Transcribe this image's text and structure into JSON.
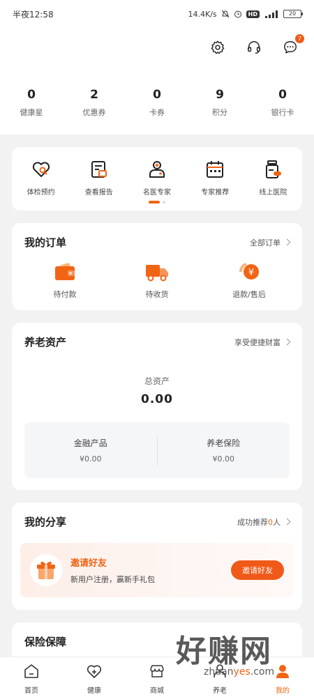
{
  "status_bar": {
    "time": "半夜12:58",
    "network_speed": "14.4K/s",
    "hd": "HD",
    "battery": "20"
  },
  "header": {
    "message_badge": "7"
  },
  "stats": [
    {
      "value": "0",
      "label": "健康星"
    },
    {
      "value": "2",
      "label": "优惠券"
    },
    {
      "value": "0",
      "label": "卡券"
    },
    {
      "value": "9",
      "label": "积分"
    },
    {
      "value": "0",
      "label": "银行卡"
    }
  ],
  "services": [
    {
      "label": "体检预约",
      "icon": "heart-search-icon"
    },
    {
      "label": "查看报告",
      "icon": "report-icon"
    },
    {
      "label": "名医专家",
      "icon": "doctor-icon"
    },
    {
      "label": "专家推荐",
      "icon": "calendar-icon"
    },
    {
      "label": "线上医院",
      "icon": "medicine-bottle-icon"
    }
  ],
  "orders": {
    "title": "我的订单",
    "all_link": "全部订单",
    "items": [
      {
        "label": "待付款",
        "icon": "wallet-icon"
      },
      {
        "label": "待收货",
        "icon": "truck-icon"
      },
      {
        "label": "退款/售后",
        "icon": "refund-icon"
      }
    ]
  },
  "assets": {
    "title": "养老资产",
    "link": "享受便捷财富",
    "total_label": "总资产",
    "total_value": "0.00",
    "items": [
      {
        "label": "金融产品",
        "value": "¥0.00"
      },
      {
        "label": "养老保险",
        "value": "¥0.00"
      }
    ]
  },
  "share": {
    "title": "我的分享",
    "link_prefix": "成功推荐",
    "link_count": "0",
    "link_suffix": "人",
    "invite_title": "邀请好友",
    "invite_subtitle": "新用户注册，赢新手礼包",
    "invite_button": "邀请好友"
  },
  "insurance": {
    "title": "保险保障"
  },
  "tabs": [
    {
      "label": "首页",
      "icon": "home-icon"
    },
    {
      "label": "健康",
      "icon": "health-plus-icon"
    },
    {
      "label": "商城",
      "icon": "shop-icon"
    },
    {
      "label": "养老",
      "icon": "elderly-icon"
    },
    {
      "label": "我的",
      "icon": "profile-icon"
    }
  ],
  "watermark": {
    "brand": "好赚网",
    "domain_prefix": "zhuan",
    "domain_accent": "yes",
    "domain_suffix": ".com"
  },
  "colors": {
    "accent": "#f06414",
    "background": "#f2f2f2"
  }
}
